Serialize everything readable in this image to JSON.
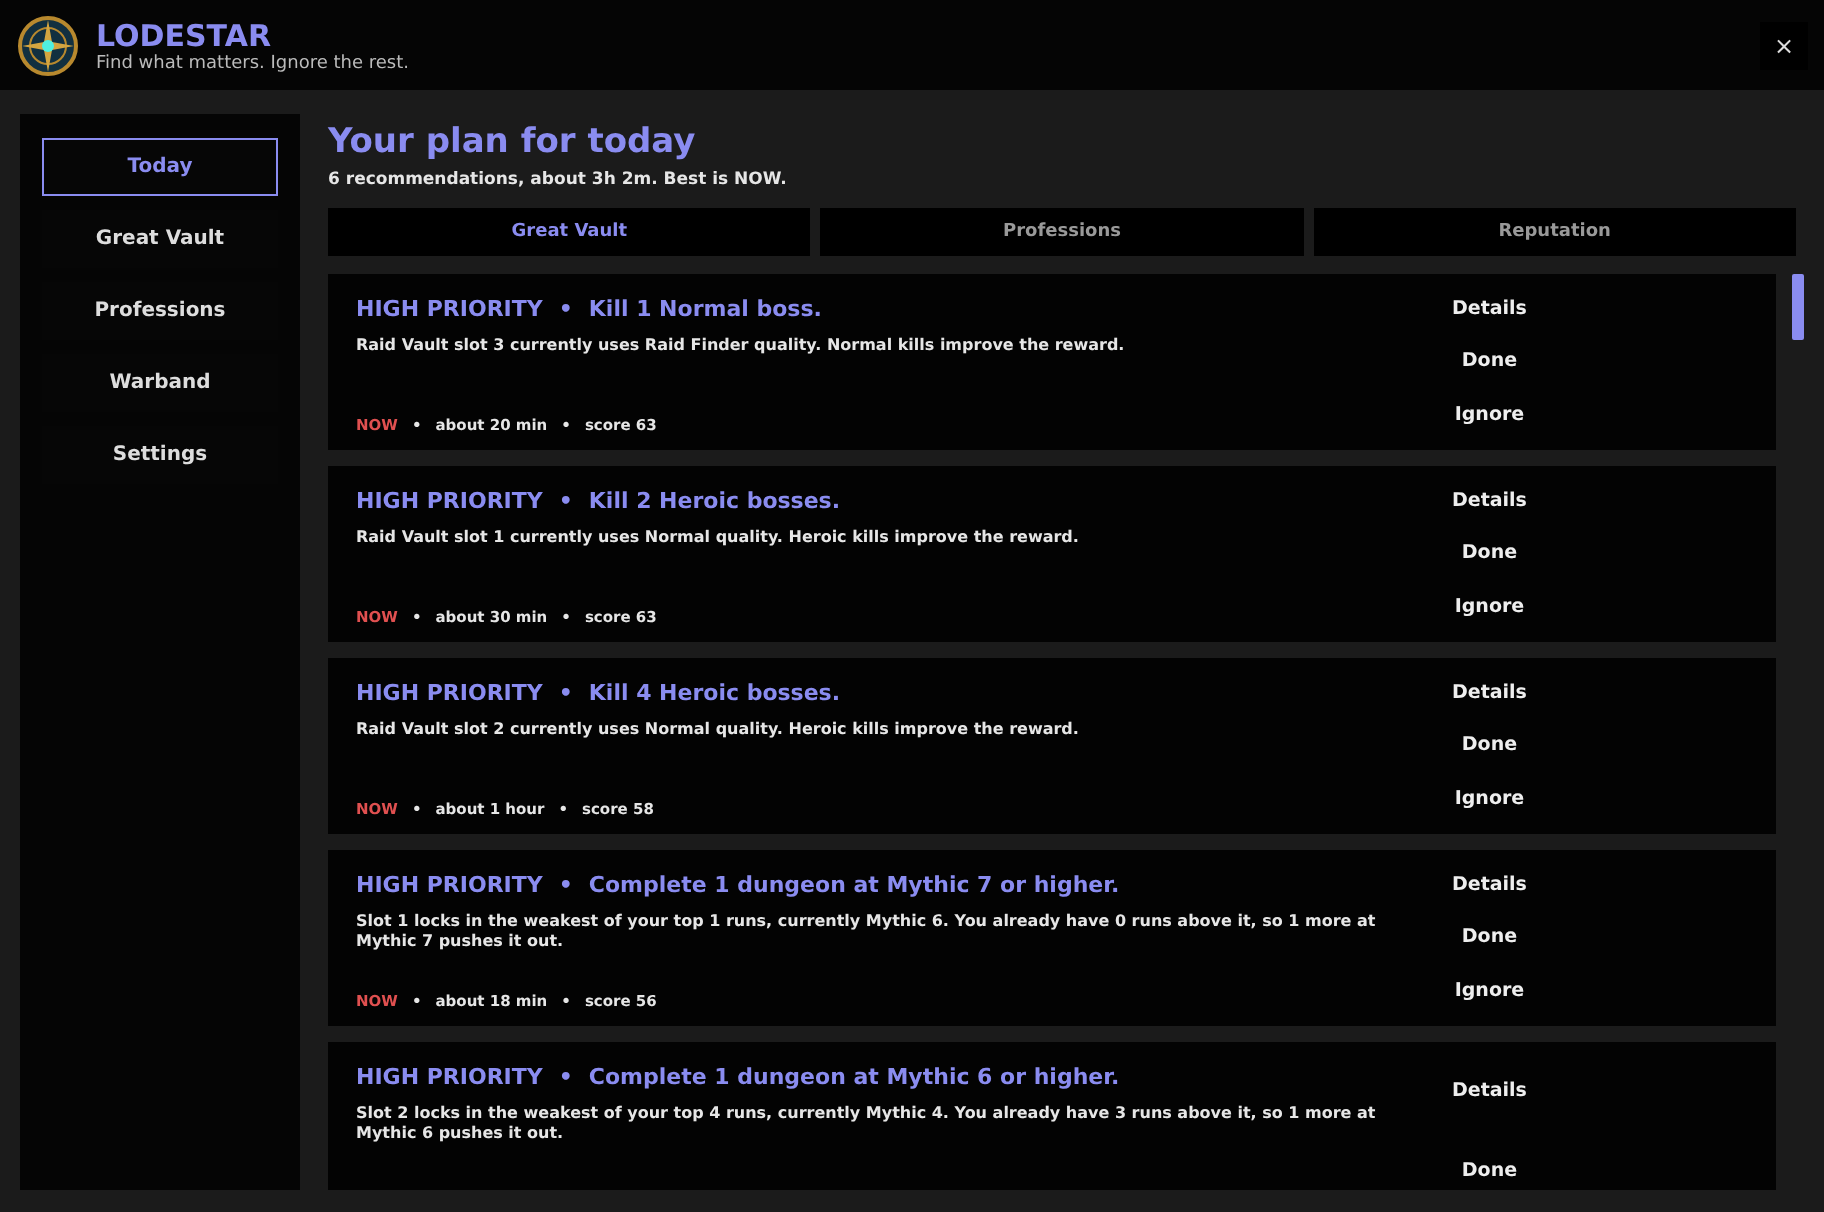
{
  "app": {
    "title": "LODESTAR",
    "tagline": "Find what matters. Ignore the rest.",
    "close": "×"
  },
  "sidebar": {
    "items": [
      {
        "label": "Today",
        "selected": true
      },
      {
        "label": "Great Vault",
        "selected": false
      },
      {
        "label": "Professions",
        "selected": false
      },
      {
        "label": "Warband",
        "selected": false
      },
      {
        "label": "Settings",
        "selected": false
      }
    ]
  },
  "main": {
    "title": "Your plan for today",
    "summary": "6 recommendations, about 3h 2m. Best is NOW.",
    "tabs": [
      {
        "label": "Great Vault",
        "selected": true
      },
      {
        "label": "Professions",
        "selected": false
      },
      {
        "label": "Reputation",
        "selected": false
      }
    ],
    "cards": [
      {
        "priority": "HIGH PRIORITY",
        "separator": "•",
        "title": "Kill 1 Normal boss.",
        "description": "Raid Vault slot 3 currently uses Raid Finder quality. Normal kills improve the reward.",
        "meta": [
          "NOW",
          "about 20 min",
          "score 63"
        ],
        "actions": [
          "Details",
          "Done",
          "Ignore"
        ]
      },
      {
        "priority": "HIGH PRIORITY",
        "separator": "•",
        "title": "Kill 2 Heroic bosses.",
        "description": "Raid Vault slot 1 currently uses Normal quality. Heroic kills improve the reward.",
        "meta": [
          "NOW",
          "about 30 min",
          "score 63"
        ],
        "actions": [
          "Details",
          "Done",
          "Ignore"
        ]
      },
      {
        "priority": "HIGH PRIORITY",
        "separator": "•",
        "title": "Kill 4 Heroic bosses.",
        "description": "Raid Vault slot 2 currently uses Normal quality. Heroic kills improve the reward.",
        "meta": [
          "NOW",
          "about 1 hour",
          "score 58"
        ],
        "actions": [
          "Details",
          "Done",
          "Ignore"
        ]
      },
      {
        "priority": "HIGH PRIORITY",
        "separator": "•",
        "title": "Complete 1 dungeon at Mythic 7 or higher.",
        "description": "Slot 1 locks in the weakest of your top 1 runs, currently Mythic 6. You already have 0 runs above it, so 1 more at Mythic 7 pushes it out.",
        "meta": [
          "NOW",
          "about 18 min",
          "score 56"
        ],
        "actions": [
          "Details",
          "Done",
          "Ignore"
        ]
      },
      {
        "priority": "HIGH PRIORITY",
        "separator": "•",
        "title": "Complete 1 dungeon at Mythic 6 or higher.",
        "description": "Slot 2 locks in the weakest of your top 4 runs, currently Mythic 4. You already have 3 runs above it, so 1 more at Mythic 6 pushes it out.",
        "actions": [
          "Details",
          "Done"
        ]
      }
    ]
  }
}
